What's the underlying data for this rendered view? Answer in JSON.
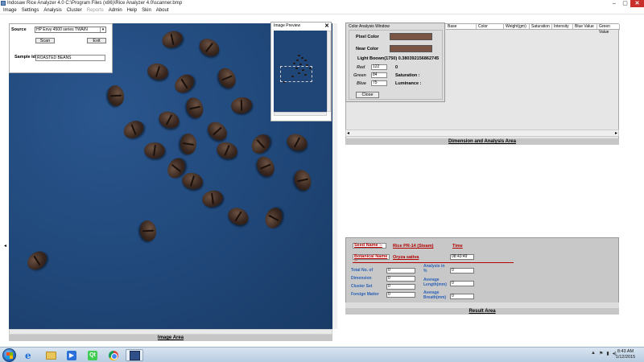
{
  "window": {
    "title": "Indosaw Rice Analyzer 4.0 C:\\Program Files (x86)\\Rice Analyzer 4.0\\scanner.bmp",
    "min_glyph": "–",
    "max_glyph": "▢",
    "close_glyph": "✕"
  },
  "menu": {
    "items": [
      "Image",
      "Settings",
      "Analysis",
      "Cluster",
      "Reports",
      "Admin",
      "Help",
      "Skin",
      "About"
    ],
    "disabled_item": "Reports"
  },
  "source_panel": {
    "source_label": "Source",
    "source_value": "HP Envy 4500 series TWAIN",
    "scan_label": "Scan",
    "exit_label": "Exit",
    "sample_id_label": "Sample Id",
    "sample_id_value": "ROASTED BEANS"
  },
  "image_preview": {
    "title": "Image Preview",
    "close_glyph": "✕"
  },
  "color_window": {
    "title": "Color Analysis Window",
    "pixel_color_label": "Pixel Color",
    "near_color_label": "Near Color",
    "swatch_color": "#7a5545",
    "light_brown_text": "Light Boown(1750) 0.380392156862745",
    "red_label": "Red",
    "red_value": "122",
    "green_label": "Green",
    "green_value": "84",
    "blue_label": "Blue",
    "blue_value": "75",
    "hue_value": "0",
    "saturation_label": "Saturation :",
    "luminance_label": "Luminance :",
    "close_label": "Close"
  },
  "dimension_area": {
    "columns": [
      "Base",
      "Color",
      "Weight(gm)",
      "Saturation",
      "Intensity",
      "Blue Value",
      "Green Value"
    ],
    "label": "Dimension and Analysis Area",
    "left_arrow": "◂",
    "right_arrow": "▸"
  },
  "image_area": {
    "label": "Image Area"
  },
  "result_area": {
    "label": "Result  Area",
    "seed_name_label": "Seed Name :-",
    "seed_name_value": "Rice PR-14 (Steam)",
    "time_label": "Time",
    "botanical_label": "Botanical Name :-",
    "botanical_value": "Oryza sativa",
    "time_value": "08:43:49",
    "fields_left": [
      {
        "label": "Total No. of",
        "value": "0"
      },
      {
        "label": "Dimension",
        "value": "0"
      },
      {
        "label": "Cluster Set",
        "value": "0"
      },
      {
        "label": "Foreign Matter",
        "value": "0"
      }
    ],
    "fields_right": [
      {
        "label": "Analysis in %",
        "value": "0"
      },
      {
        "label": "Average Length(mm)",
        "value": "0"
      },
      {
        "label": "Average Breath(mm)",
        "value": "0"
      }
    ]
  },
  "taskbar": {
    "clock_time": "8:43 AM",
    "clock_date": "1/12/2015",
    "tray_icons": [
      "▲",
      "⚑",
      "▮",
      "◂)"
    ]
  }
}
